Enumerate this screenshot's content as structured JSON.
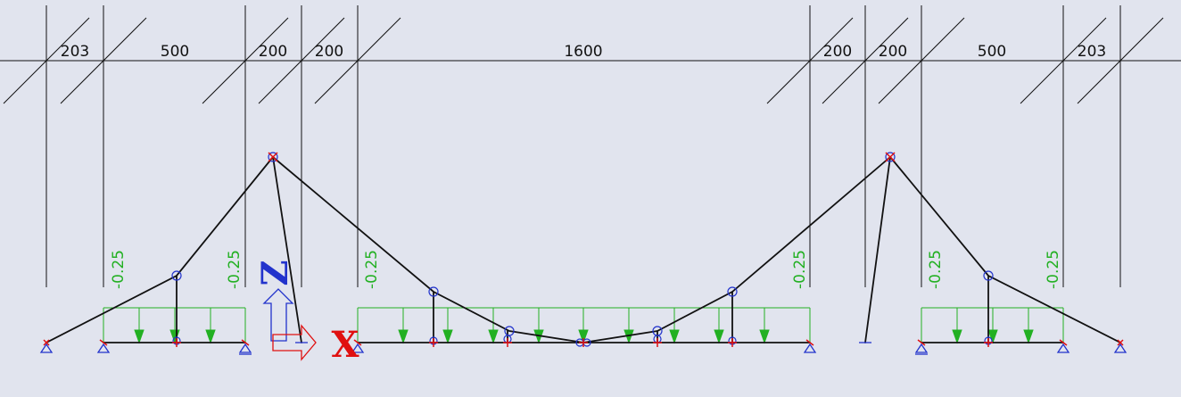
{
  "colors": {
    "background": "#e1e4ee",
    "structure": "#111111",
    "load": "#22b022",
    "node_marker": "#2233cc",
    "support": "#2233cc",
    "hinge": "#e01010",
    "axis_z": "#2233cc",
    "axis_x": "#e01010"
  },
  "dimensions": [
    "203",
    "500",
    "200",
    "200",
    "1600",
    "200",
    "200",
    "500",
    "203"
  ],
  "load_labels": [
    "-0.25",
    "-0.25",
    "-0.25",
    "-0.25",
    "-0.25",
    "-0.25"
  ],
  "axes": {
    "z": "Z",
    "x": "X"
  }
}
